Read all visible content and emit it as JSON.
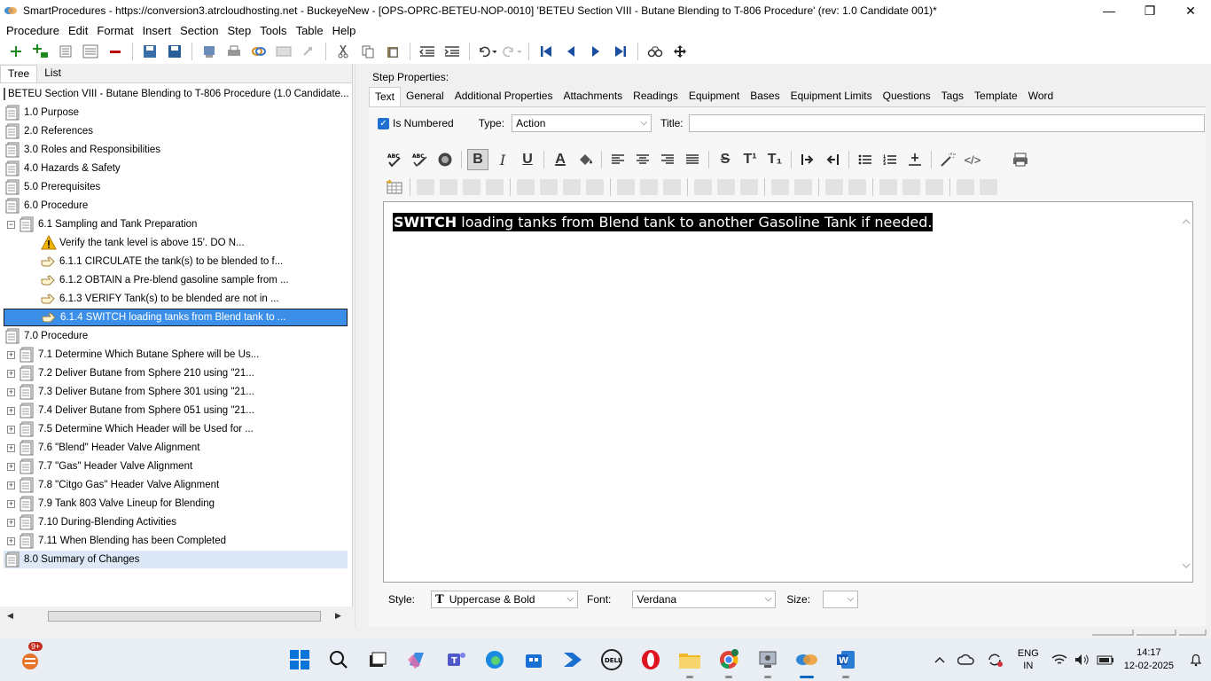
{
  "window": {
    "title": "SmartProcedures - https://conversion3.atrcloudhosting.net - BuckeyeNew - [OPS-OPRC-BETEU-NOP-0010] 'BETEU Section VIII - Butane Blending to T-806 Procedure' (rev: 1.0 Candidate 001)*",
    "minimize": "—",
    "restore": "❐",
    "close": "✕"
  },
  "menu": [
    "Procedure",
    "Edit",
    "Format",
    "Insert",
    "Section",
    "Step",
    "Tools",
    "Table",
    "Help"
  ],
  "left": {
    "tabs": [
      "Tree",
      "List"
    ],
    "root": "BETEU Section VIII - Butane Blending to T-806 Procedure (1.0 Candidate...",
    "items": [
      {
        "label": "1.0 Purpose"
      },
      {
        "label": "2.0 References"
      },
      {
        "label": "3.0 Roles and Responsibilities"
      },
      {
        "label": "4.0 Hazards & Safety"
      },
      {
        "label": "5.0 Prerequisites"
      },
      {
        "label": "6.0 Procedure"
      },
      {
        "label": "6.1 Sampling and Tank Preparation"
      },
      {
        "label": "Verify the tank level is above 15'. DO N..."
      },
      {
        "label": "6.1.1 CIRCULATE the tank(s) to be blended to f..."
      },
      {
        "label": "6.1.2 OBTAIN a Pre-blend gasoline sample from ..."
      },
      {
        "label": "6.1.3 VERIFY Tank(s) to be blended are not in ..."
      },
      {
        "label": "6.1.4 SWITCH loading tanks from Blend tank to ..."
      },
      {
        "label": "7.0 Procedure"
      },
      {
        "label": "7.1 Determine Which Butane Sphere will be Us..."
      },
      {
        "label": "7.2 Deliver Butane from Sphere 210 using \"21..."
      },
      {
        "label": "7.3 Deliver Butane from Sphere 301 using \"21..."
      },
      {
        "label": "7.4 Deliver Butane from Sphere 051 using \"21..."
      },
      {
        "label": "7.5 Determine Which Header will be Used for ..."
      },
      {
        "label": "7.6 \"Blend\" Header Valve Alignment"
      },
      {
        "label": "7.7 \"Gas\" Header Valve Alignment"
      },
      {
        "label": "7.8 \"Citgo Gas\" Header Valve Alignment"
      },
      {
        "label": "7.9 Tank 803 Valve Lineup for Blending"
      },
      {
        "label": "7.10 During-Blending Activities"
      },
      {
        "label": "7.11 When Blending has been Completed"
      },
      {
        "label": "8.0 Summary of Changes"
      }
    ]
  },
  "right": {
    "heading": "Step Properties:",
    "tabs": [
      "Text",
      "General",
      "Additional Properties",
      "Attachments",
      "Readings",
      "Equipment",
      "Bases",
      "Equipment Limits",
      "Questions",
      "Tags",
      "Template",
      "Word"
    ],
    "is_numbered_label": "Is Numbered",
    "type_label": "Type:",
    "type_value": "Action",
    "title_label": "Title:",
    "title_value": "",
    "editor_bold": "SWITCH",
    "editor_rest": " loading tanks from Blend tank to another Gasoline Tank if needed.",
    "style_label": "Style:",
    "style_value": "Uppercase & Bold",
    "font_label": "Font:",
    "font_value": "Verdana",
    "size_label": "Size:",
    "size_value": ""
  },
  "format_buttons": [
    "B",
    "I",
    "U",
    "A",
    "S",
    "T¹",
    "T₁",
    "</>"
  ],
  "taskbar": {
    "notification_badge": "9+",
    "lang": "ENG",
    "region": "IN",
    "time": "14:17",
    "date": "12-02-2025"
  }
}
